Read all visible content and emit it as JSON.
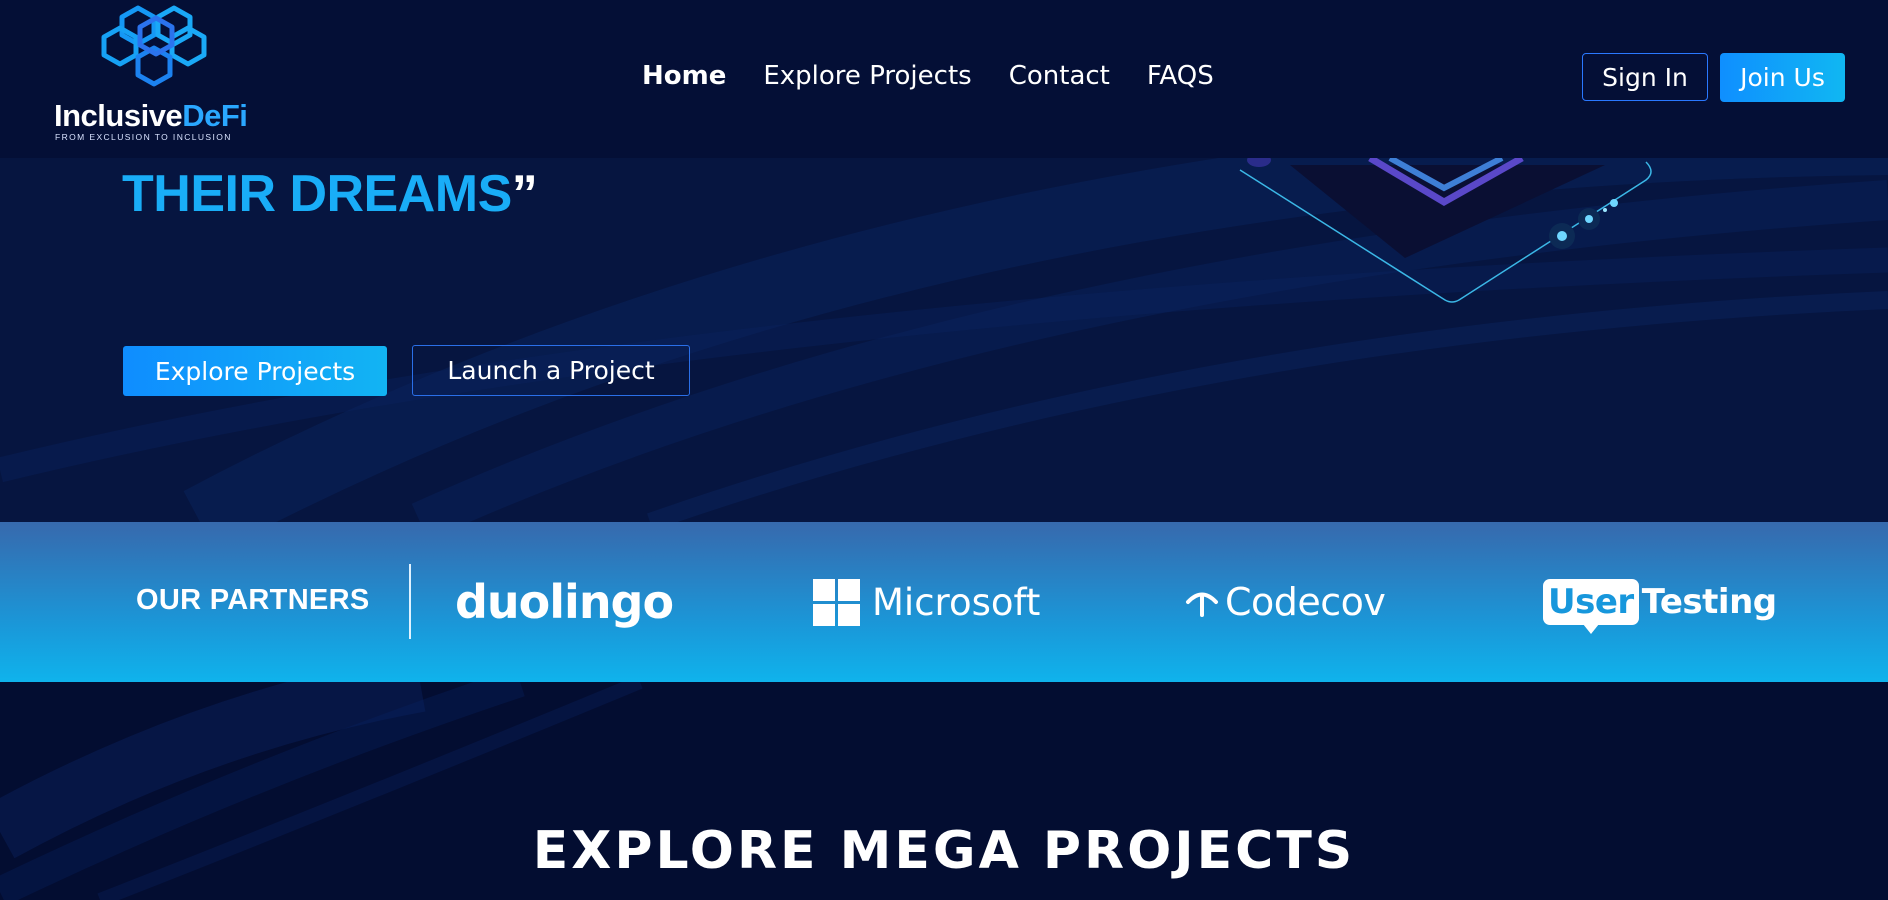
{
  "header": {
    "logo": {
      "word_inclusive": "Inclusive",
      "word_defi": "DeFi",
      "tagline": "FROM EXCLUSION TO INCLUSION"
    },
    "nav": [
      {
        "label": "Home",
        "active": true
      },
      {
        "label": "Explore Projects",
        "active": false
      },
      {
        "label": "Contact",
        "active": false
      },
      {
        "label": "FAQS",
        "active": false
      }
    ],
    "sign_in_label": "Sign In",
    "join_label": "Join Us"
  },
  "hero": {
    "title_line": "THEIR DREAMS",
    "title_quote": "”",
    "explore_button": "Explore Projects",
    "launch_button": "Launch a Project"
  },
  "partners": {
    "label": "OUR PARTNERS",
    "logos": [
      {
        "name": "duolingo",
        "text": "duolingo"
      },
      {
        "name": "microsoft",
        "text": "Microsoft"
      },
      {
        "name": "codecov",
        "text": "Codecov"
      },
      {
        "name": "usertesting",
        "text_a": "User",
        "text_b": "Testing"
      }
    ]
  },
  "mega": {
    "title": "EXPLORE MEGA PROJECTS"
  },
  "colors": {
    "background": "#061540",
    "header": "#040f36",
    "accent": "#19adf7",
    "button_gradient_start": "#0f8dff",
    "button_gradient_end": "#12b4f3",
    "partners_band_top": "#3769ad",
    "partners_band_bottom": "#0fb3ec"
  }
}
